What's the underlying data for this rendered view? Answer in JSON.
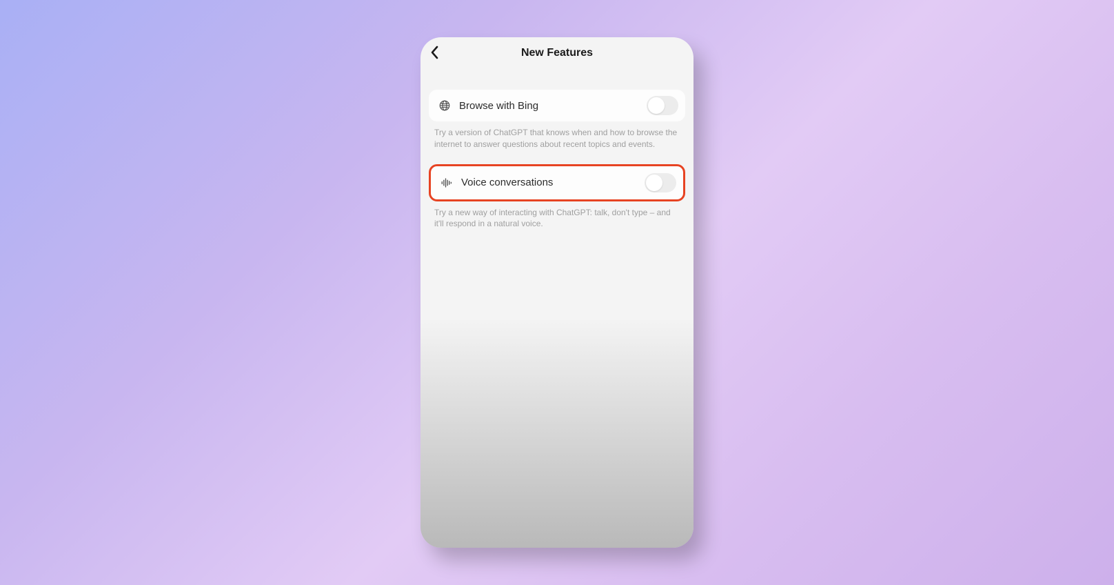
{
  "header": {
    "title": "New Features"
  },
  "features": [
    {
      "label": "Browse with Bing",
      "description": "Try a version of ChatGPT that knows when and how to browse the internet to answer questions about recent topics and events.",
      "highlighted": false
    },
    {
      "label": "Voice conversations",
      "description": "Try a new way of interacting with ChatGPT: talk, don't type – and it'll respond in a natural voice.",
      "highlighted": true
    }
  ],
  "colors": {
    "highlight": "#e74322"
  }
}
